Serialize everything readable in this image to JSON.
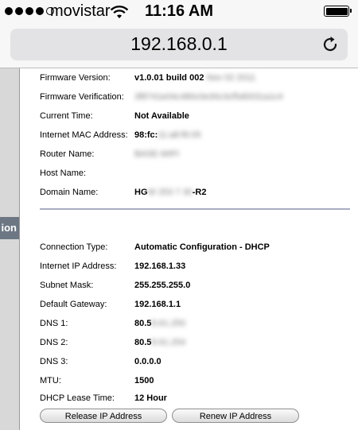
{
  "status_bar": {
    "carrier": "movistar",
    "time": "11:16 AM",
    "signal_bars_filled": 4,
    "signal_bars_total": 5
  },
  "browser": {
    "url": "192.168.0.1"
  },
  "sidebar": {
    "tab_label": "ion"
  },
  "router_info": [
    {
      "label": "Firmware Version:",
      "value": "v1.0.01 build 002",
      "redacted": "Nov 02 2011"
    },
    {
      "label": "Firmware Verification:",
      "value": "",
      "redacted": "3f8741e04c480c0e30c3cf5d0031a1c4"
    },
    {
      "label": "Current Time:",
      "value": "Not Available",
      "redacted": ""
    },
    {
      "label": "Internet MAC Address:",
      "value": "98:fc:",
      "redacted": "11:a8:f6:05"
    },
    {
      "label": "Router Name:",
      "value": "",
      "redacted": "BASE-WIFI"
    },
    {
      "label": "Host Name:",
      "value": "",
      "redacted": ""
    },
    {
      "label": "Domain Name:",
      "value": "HG",
      "redacted": "W 253 7 30",
      "suffix": "-R2"
    }
  ],
  "connection_info": [
    {
      "label": "Connection Type:",
      "value": "Automatic Configuration - DHCP",
      "redacted": ""
    },
    {
      "label": "Internet IP Address:",
      "value": "192.168.1.33",
      "redacted": ""
    },
    {
      "label": "Subnet Mask:",
      "value": "255.255.255.0",
      "redacted": ""
    },
    {
      "label": "Default Gateway:",
      "value": "192.168.1.1",
      "redacted": ""
    },
    {
      "label": "DNS 1:",
      "value": "80.5",
      "redacted": "8.61.250"
    },
    {
      "label": "DNS 2:",
      "value": "80.5",
      "redacted": "8.61.254"
    },
    {
      "label": "DNS 3:",
      "value": "0.0.0.0",
      "redacted": ""
    },
    {
      "label": "MTU:",
      "value": "1500",
      "redacted": ""
    },
    {
      "label": "DHCP Lease Time:",
      "value": "12 Hour",
      "redacted": ""
    }
  ],
  "buttons": {
    "release": "Release IP Address",
    "renew": "Renew IP Address"
  },
  "icons": {
    "wifi": "wifi-icon",
    "battery": "battery-icon",
    "reload": "reload-icon"
  }
}
